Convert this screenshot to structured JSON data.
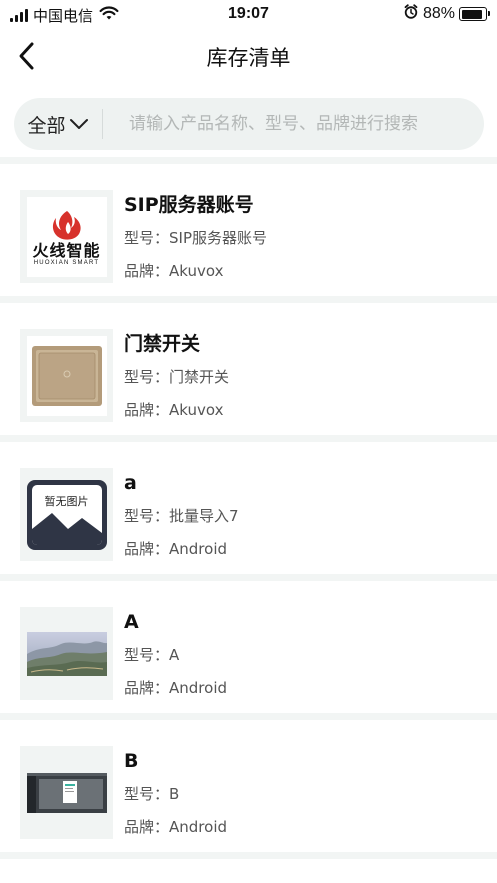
{
  "status_bar": {
    "carrier": "中国电信",
    "time": "19:07",
    "battery": "88%",
    "battery_level": 0.88
  },
  "nav": {
    "title": "库存清单"
  },
  "search": {
    "category": "全部",
    "placeholder": "请输入产品名称、型号、品牌进行搜索"
  },
  "labels": {
    "model_prefix": "型号：",
    "brand_prefix": "品牌："
  },
  "items": [
    {
      "name": "SIP服务器账号",
      "model": "SIP服务器账号",
      "brand": "Akuvox",
      "thumb": "logo",
      "logo_text": "火线智能",
      "logo_sub": "HUOXIAN SMART"
    },
    {
      "name": "门禁开关",
      "model": "门禁开关",
      "brand": "Akuvox",
      "thumb": "panel"
    },
    {
      "name": "a",
      "model": "批量导入7",
      "brand": "Android",
      "thumb": "placeholder",
      "placeholder_text": "暂无图片"
    },
    {
      "name": "A",
      "model": "A",
      "brand": "Android",
      "thumb": "landscape"
    },
    {
      "name": "B",
      "model": "B",
      "brand": "Android",
      "thumb": "screen"
    }
  ],
  "colors": {
    "logo_red": "#d7322c",
    "panel_gold": "#b39b7a",
    "placeholder_dark": "#2f3545",
    "background_tint": "#eef2f1"
  }
}
